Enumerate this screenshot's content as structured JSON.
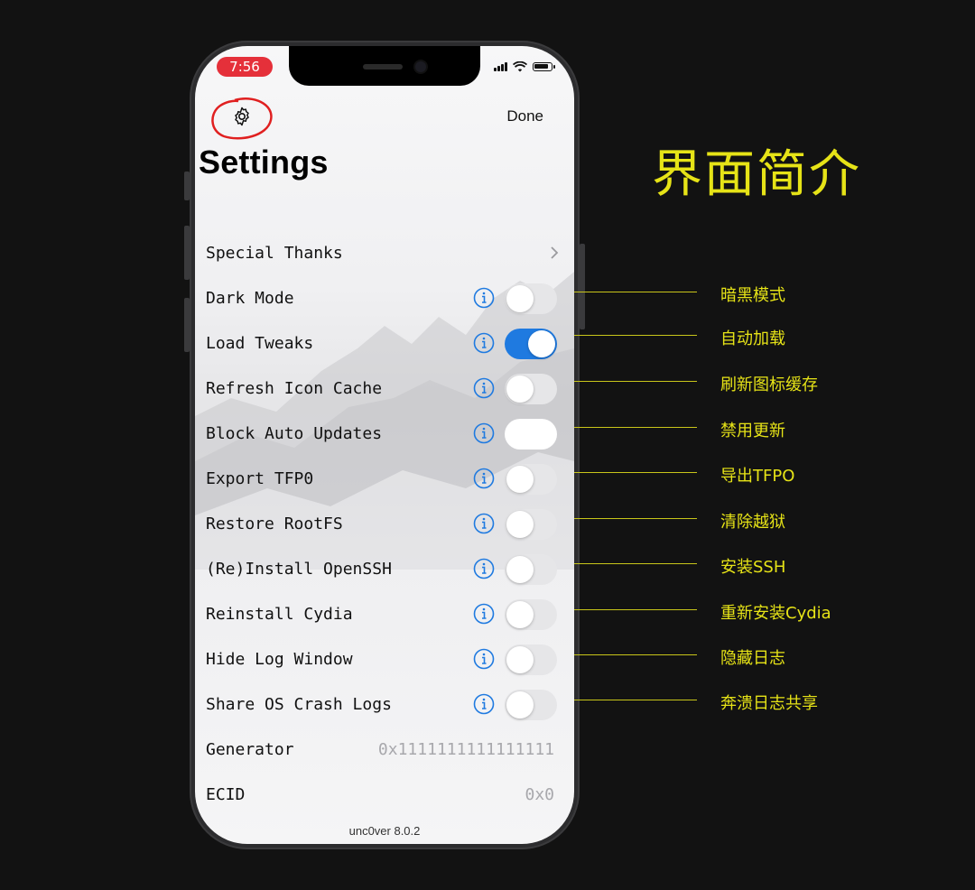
{
  "status_bar": {
    "time": "7:56"
  },
  "nav": {
    "done_label": "Done",
    "title": "Settings"
  },
  "rows": [
    {
      "label": "Special Thanks",
      "kind": "link"
    },
    {
      "label": "Dark Mode",
      "kind": "toggle",
      "on": false
    },
    {
      "label": "Load Tweaks",
      "kind": "toggle",
      "on": true
    },
    {
      "label": "Refresh Icon Cache",
      "kind": "toggle",
      "on": false
    },
    {
      "label": "Block Auto Updates",
      "kind": "toggle",
      "on": false
    },
    {
      "label": "Export TFP0",
      "kind": "toggle",
      "on": false
    },
    {
      "label": "Restore RootFS",
      "kind": "toggle",
      "on": false
    },
    {
      "label": "(Re)Install OpenSSH",
      "kind": "toggle",
      "on": false
    },
    {
      "label": "Reinstall Cydia",
      "kind": "toggle",
      "on": false
    },
    {
      "label": "Hide Log Window",
      "kind": "toggle",
      "on": false
    },
    {
      "label": "Share OS Crash Logs",
      "kind": "toggle",
      "on": false
    },
    {
      "label": "Generator",
      "kind": "value",
      "value": "0x1111111111111111"
    },
    {
      "label": "ECID",
      "kind": "value",
      "value": "0x0"
    }
  ],
  "version": "unc0ver 8.0.2",
  "annotation": {
    "title": "界面简介",
    "labels": [
      "暗黑模式",
      "自动加载",
      "刷新图标缓存",
      "禁用更新",
      "导出TFPO",
      "清除越狱",
      "安装SSH",
      "重新安装Cydia",
      "隐藏日志",
      "奔溃日志共享"
    ]
  },
  "colors": {
    "accent": "#1f7ae0",
    "annotation": "#e6e317",
    "time_pill": "#e5303a",
    "highlight_circle": "#e02020"
  },
  "icons": {
    "settings": "gear-icon",
    "info": "info-icon",
    "chevron": "chevron-right-icon"
  }
}
